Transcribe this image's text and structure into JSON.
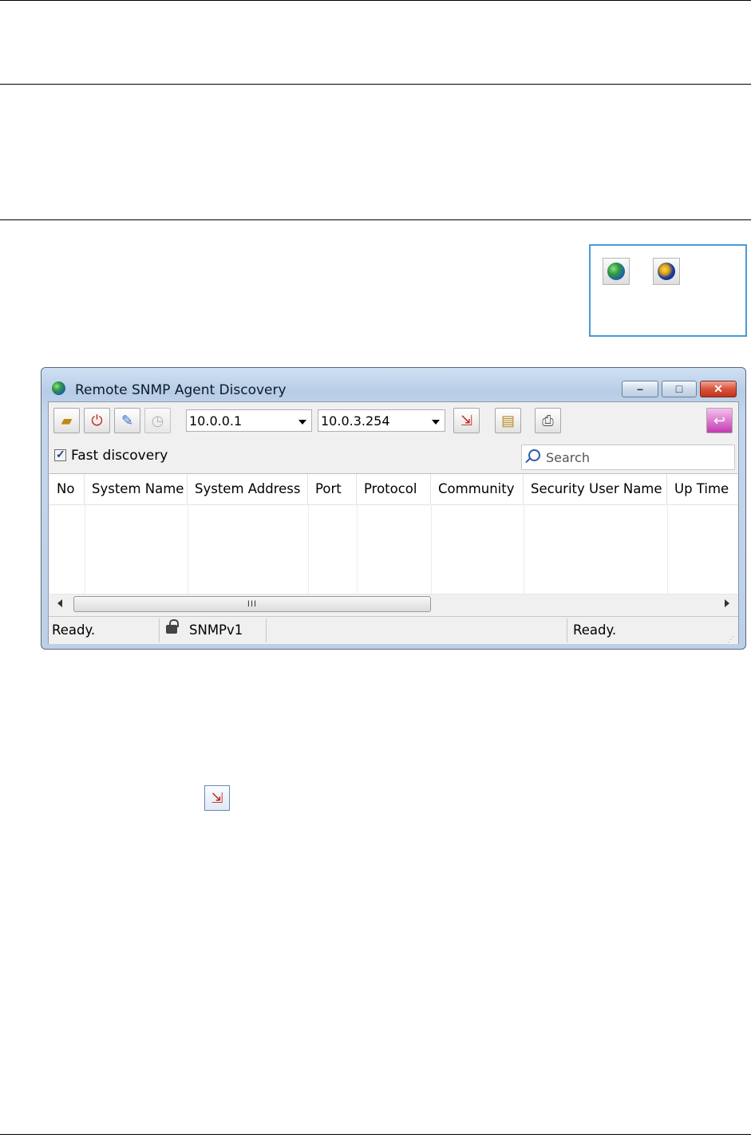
{
  "window": {
    "title": "Remote SNMP Agent Discovery",
    "minimize_glyph": "–",
    "maximize_glyph": "□",
    "close_glyph": "✕"
  },
  "toolbar": {
    "start_ip": "10.0.0.1",
    "end_ip": "10.0.3.254",
    "icons": [
      "open-folder-icon",
      "stop-icon",
      "edit-icon",
      "clock-icon",
      "discover-icon",
      "export-icon",
      "print-icon",
      "exit-icon"
    ]
  },
  "options": {
    "fast_discovery_label": "Fast discovery",
    "fast_discovery_checked": true,
    "search_placeholder": "Search"
  },
  "table": {
    "columns": [
      "No",
      "System Name",
      "System Address",
      "Port",
      "Protocol",
      "Community",
      "Security User Name",
      "Up Time"
    ],
    "rows": [],
    "scroll_grip": "III"
  },
  "status": {
    "left": "Ready.",
    "protocol": "SNMPv1",
    "right": "Ready."
  },
  "colors": {
    "accent_border": "#4a9bd6",
    "close_button": "#c4321a"
  }
}
